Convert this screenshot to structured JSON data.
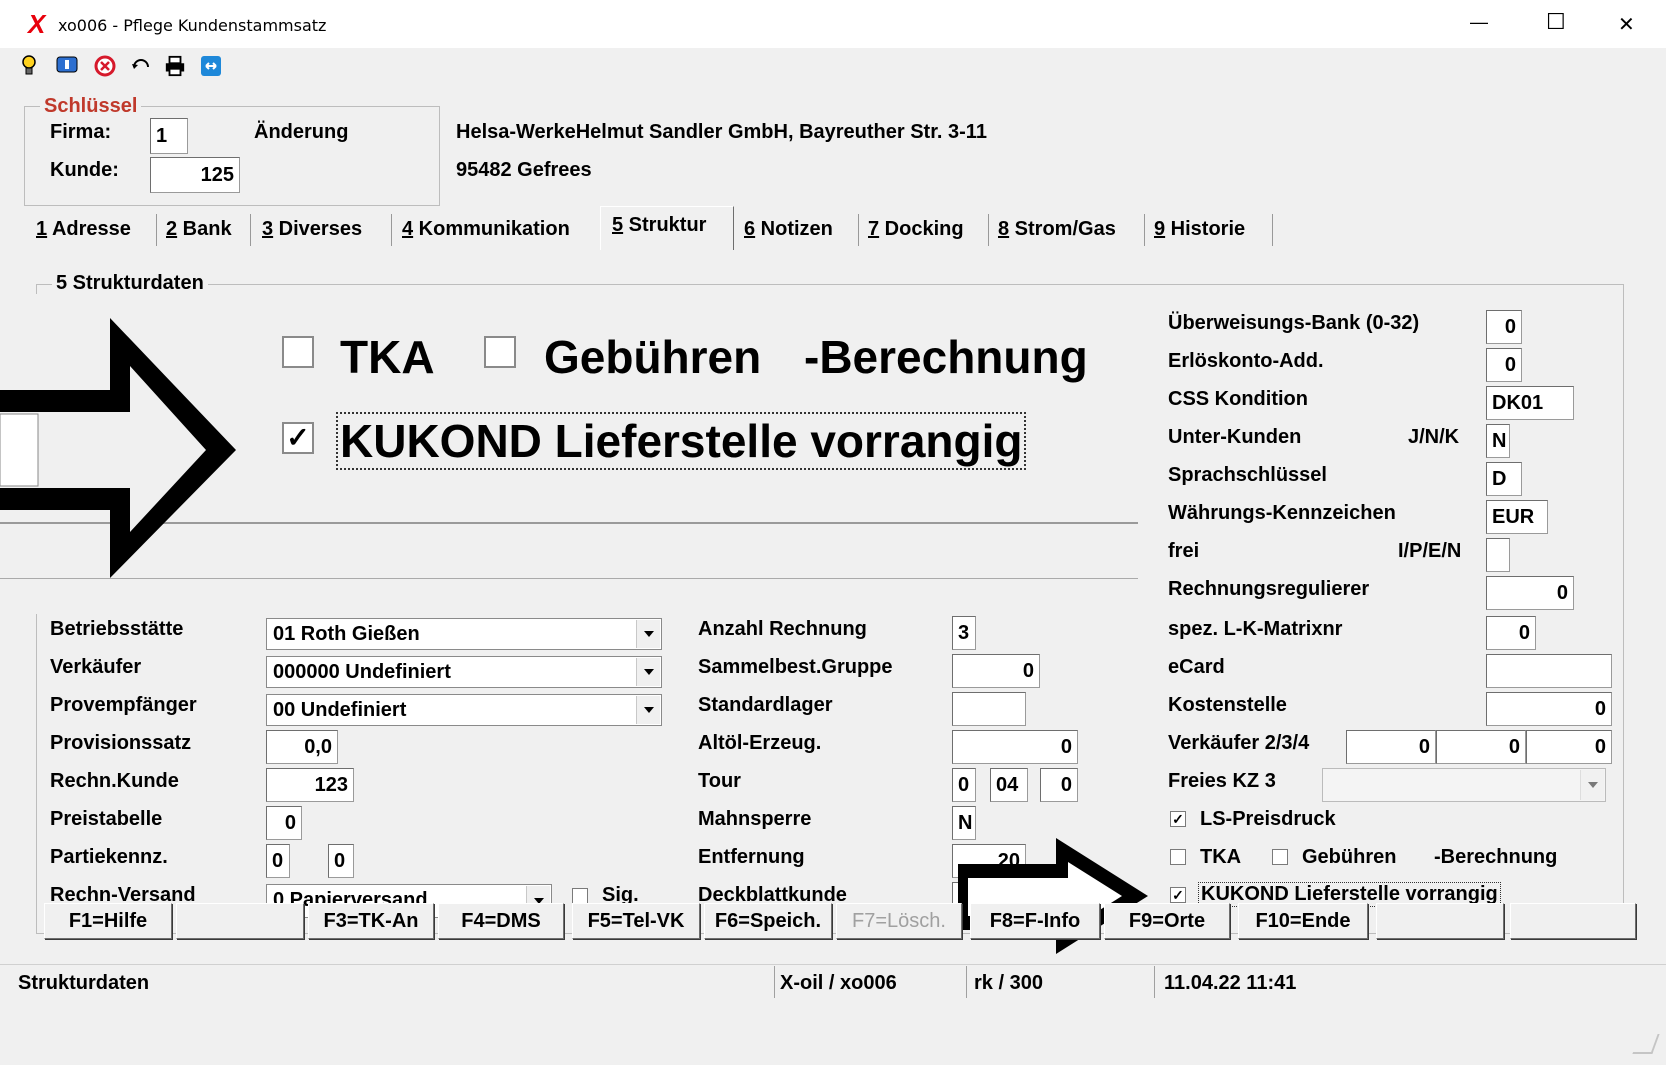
{
  "window": {
    "title": "xo006 - Pflege Kundenstammsatz",
    "minimize": "—",
    "maximize": "☐",
    "close": "✕"
  },
  "toolbar": [
    "bulb-icon",
    "info-icon",
    "cancel-icon",
    "refresh-icon",
    "printer-icon",
    "exit-icon"
  ],
  "key": {
    "group_title": "Schlüssel",
    "firma_label": "Firma:",
    "firma_value": "1",
    "mode": "Änderung",
    "kunde_label": "Kunde:",
    "kunde_value": "125",
    "address_line1": "Helsa-WerkeHelmut Sandler GmbH, Bayreuther Str. 3-11",
    "address_line2": "95482 Gefrees"
  },
  "tabs": [
    {
      "num": "1",
      "label": " Adresse"
    },
    {
      "num": "2",
      "label": " Bank"
    },
    {
      "num": "3",
      "label": " Diverses"
    },
    {
      "num": "4",
      "label": " Kommunikation"
    },
    {
      "num": "5",
      "label": " Struktur"
    },
    {
      "num": "6",
      "label": " Notizen"
    },
    {
      "num": "7",
      "label": " Docking"
    },
    {
      "num": "8",
      "label": " Strom/Gas"
    },
    {
      "num": "9",
      "label": " Historie"
    }
  ],
  "section_title": "5 Strukturdaten",
  "zoom": {
    "tka": "TKA",
    "gebuehren": "Gebühren",
    "berechnung": "-Berechnung",
    "kukond": "KUKOND Lieferstelle vorrangig"
  },
  "left": {
    "betriebsstaette_label": "Betriebsstätte",
    "betriebsstaette_value": "01 Roth Gießen",
    "verkaeufer_label": "Verkäufer",
    "verkaeufer_value": "000000 Undefiniert",
    "provempfaenger_label": "Provempfänger",
    "provempfaenger_value": "00 Undefiniert",
    "provisionssatz_label": "Provisionssatz",
    "provisionssatz_value": "0,0",
    "rechnkunde_label": "Rechn.Kunde",
    "rechnkunde_value": "123",
    "preistabelle_label": "Preistabelle",
    "preistabelle_value": "0",
    "partiekennz_label": "Partiekennz.",
    "partiekennz_value1": "0",
    "partiekennz_value2": "0",
    "rechnversand_label": "Rechn-Versand",
    "rechnversand_value": "0 Papierversand",
    "sig_label": "Sig."
  },
  "middle": {
    "anzahl_rechnung_label": "Anzahl Rechnung",
    "anzahl_rechnung_value": "3",
    "sammelbest_label": "Sammelbest.Gruppe",
    "sammelbest_value": "0",
    "standardlager_label": "Standardlager",
    "standardlager_value": "",
    "altoel_label": "Altöl-Erzeug.",
    "altoel_value": "0",
    "tour_label": "Tour",
    "tour_value1": "0",
    "tour_value2": "04",
    "tour_value3": "0",
    "mahnsperre_label": "Mahnsperre",
    "mahnsperre_value": "N",
    "entfernung_label": "Entfernung",
    "entfernung_value": "20",
    "deckblatt_label": "Deckblattkunde"
  },
  "right": {
    "ueberweisungsbank_label": "Überweisungs-Bank (0-32)",
    "ueberweisungsbank_value": "0",
    "erloeskonto_label": "Erlöskonto-Add.",
    "erloeskonto_value": "0",
    "css_label": "CSS Kondition",
    "css_value": "DK01",
    "unterkunden_label": "Unter-Kunden",
    "unterkunden_hint": "J/N/K",
    "unterkunden_value": "N",
    "sprach_label": "Sprachschlüssel",
    "sprach_value": "D",
    "waehrung_label": "Währungs-Kennzeichen",
    "waehrung_value": "EUR",
    "frei_label": "frei",
    "frei_hint": "I/P/E/N",
    "frei_value": "",
    "rechnungsregulierer_label": "Rechnungsregulierer",
    "rechnungsregulierer_value": "0",
    "matrix_label": "spez. L-K-Matrixnr",
    "matrix_value": "0",
    "ecard_label": "eCard",
    "ecard_value": "",
    "kostenstelle_label": "Kostenstelle",
    "kostenstelle_value": "0",
    "verkaeufer234_label": "Verkäufer 2/3/4",
    "verkaeufer234_values": [
      "0",
      "0",
      "0"
    ],
    "freieskz3_label": "Freies KZ 3",
    "ls_preisdruck_label": "LS-Preisdruck",
    "tka_label": "TKA",
    "gebuehren_label": "Gebühren",
    "berechnung_label": "-Berechnung",
    "kukond_label": "KUKOND Lieferstelle vorrangig"
  },
  "fkeys": [
    {
      "label": "F1=Hilfe",
      "enabled": true
    },
    {
      "label": "",
      "enabled": true
    },
    {
      "label": "F3=TK-An",
      "enabled": true
    },
    {
      "label": "F4=DMS",
      "enabled": true
    },
    {
      "label": "F5=Tel-VK",
      "enabled": true
    },
    {
      "label": "F6=Speich.",
      "enabled": true
    },
    {
      "label": "F7=Lösch.",
      "enabled": false
    },
    {
      "label": "F8=F-Info",
      "enabled": true
    },
    {
      "label": "F9=Orte",
      "enabled": true
    },
    {
      "label": "F10=Ende",
      "enabled": true
    },
    {
      "label": "",
      "enabled": true
    },
    {
      "label": "",
      "enabled": true
    }
  ],
  "statusbar": {
    "left": "Strukturdaten",
    "system": "X-oil / xo006",
    "user": "rk / 300",
    "datetime": "11.04.22 11:41"
  },
  "colors": {
    "group_title": "#c0392b",
    "logo": "#e8000b",
    "arrow": "#000000"
  }
}
